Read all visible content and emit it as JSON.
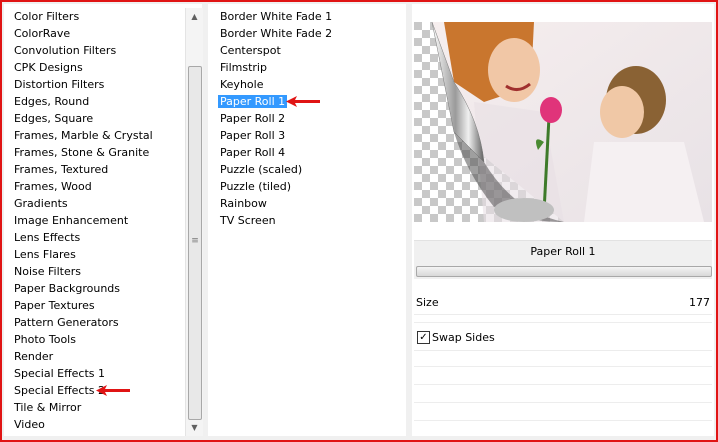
{
  "categories": [
    "Color Filters",
    "ColorRave",
    "Convolution Filters",
    "CPK Designs",
    "Distortion Filters",
    "Edges, Round",
    "Edges, Square",
    "Frames, Marble & Crystal",
    "Frames, Stone & Granite",
    "Frames, Textured",
    "Frames, Wood",
    "Gradients",
    "Image Enhancement",
    "Lens Effects",
    "Lens Flares",
    "Noise Filters",
    "Paper Backgrounds",
    "Paper Textures",
    "Pattern Generators",
    "Photo Tools",
    "Render",
    "Special Effects 1",
    "Special Effects 2",
    "Tile & Mirror",
    "Video"
  ],
  "filters": [
    "Border White Fade 1",
    "Border White Fade 2",
    "Centerspot",
    "Filmstrip",
    "Keyhole",
    "Paper Roll 1",
    "Paper Roll 2",
    "Paper Roll 3",
    "Paper Roll 4",
    "Puzzle (scaled)",
    "Puzzle (tiled)",
    "Rainbow",
    "TV Screen"
  ],
  "selected_category_index": 22,
  "selected_filter_index": 5,
  "effect_name": "Paper Roll 1",
  "size_label": "Size",
  "size_value": "177",
  "swap_label": "Swap Sides",
  "swap_checked": true,
  "scroll_grip": "≡",
  "checkmark": "✓",
  "colors": {
    "frame_border": "#e01414",
    "arrow": "#e01414",
    "selection": "#3399ff"
  }
}
